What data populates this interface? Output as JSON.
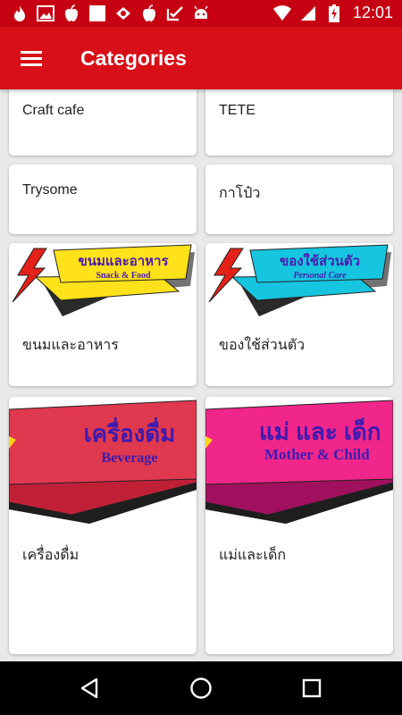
{
  "status_bar": {
    "time": "12:01",
    "left_icons": [
      "fire-icon",
      "image-icon",
      "apple-icon",
      "square-icon",
      "shield-icon",
      "apple-icon",
      "check-icon",
      "android-icon"
    ],
    "right_icons": [
      "wifi-icon",
      "signal-icon",
      "battery-charging-icon"
    ]
  },
  "app_bar": {
    "title": "Categories",
    "menu_icon": "hamburger-menu-icon",
    "color": "#d80f17"
  },
  "categories": [
    {
      "label": "Craft cafe",
      "has_image": false
    },
    {
      "label": "TETE",
      "has_image": false
    },
    {
      "label": "Trysome",
      "has_image": false
    },
    {
      "label": "กาโป๋ว",
      "has_image": false
    },
    {
      "label": "ขนมและอาหาร",
      "has_image": true,
      "banner_title": "ขนมและอาหาร",
      "banner_subtitle": "Snack & Food",
      "banner_color": "#ffe21a"
    },
    {
      "label": "ของใช้ส่วนตัว",
      "has_image": true,
      "banner_title": "ของใช้ส่วนตัว",
      "banner_subtitle": "Personal Care",
      "banner_color": "#16c5df"
    },
    {
      "label": "เครื่องดื่ม",
      "has_image": true,
      "banner_title": "เครื่องดื่ม",
      "banner_subtitle": "Beverage",
      "banner_color": "#e0384e"
    },
    {
      "label": "แม่และเด็ก",
      "has_image": true,
      "banner_title": "แม่ และ เด็ก",
      "banner_subtitle": "Mother & Child",
      "banner_color": "#f0268a"
    }
  ],
  "nav_bar": {
    "back_icon": "back-triangle-icon",
    "home_icon": "home-circle-icon",
    "recents_icon": "recents-square-icon"
  }
}
